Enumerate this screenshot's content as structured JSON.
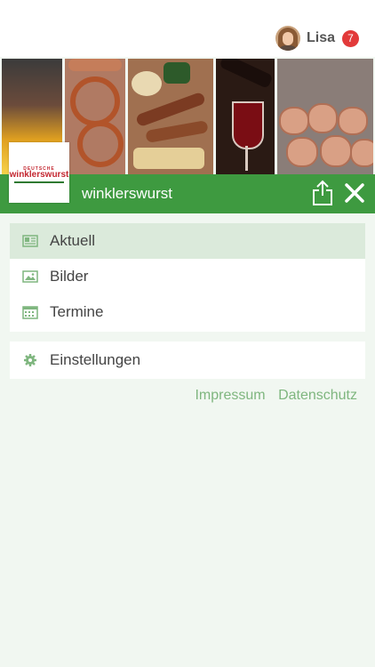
{
  "header": {
    "username": "Lisa",
    "notification_count": "7"
  },
  "banner": {
    "logo_subtext": "DEUTSCHE",
    "logo_text": "winklerswurst"
  },
  "bar": {
    "title": "winklerswurst",
    "share_icon": "share-icon",
    "close_icon": "close-icon",
    "color": "#3e9a40"
  },
  "menu": {
    "items": [
      {
        "label": "Aktuell",
        "icon": "newspaper-icon",
        "active": true
      },
      {
        "label": "Bilder",
        "icon": "image-icon",
        "active": false
      },
      {
        "label": "Termine",
        "icon": "calendar-icon",
        "active": false
      }
    ],
    "settings": {
      "label": "Einstellungen",
      "icon": "gear-icon"
    }
  },
  "footer_links": {
    "impressum": "Impressum",
    "datenschutz": "Datenschutz",
    "color": "#7fb67f"
  }
}
